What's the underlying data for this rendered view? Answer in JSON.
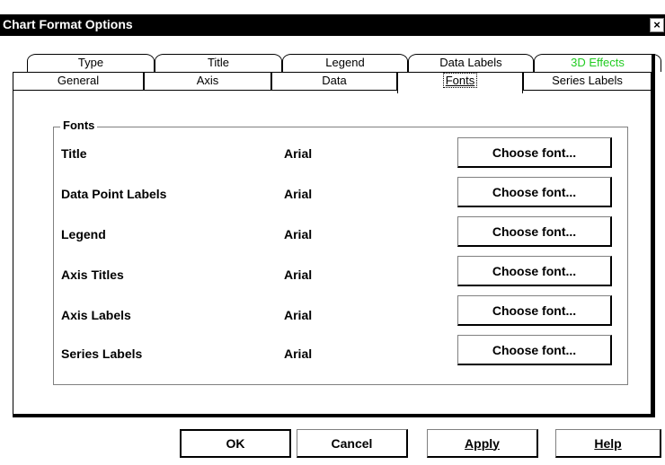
{
  "window": {
    "title": "Chart Format Options",
    "close_glyph": "×"
  },
  "tabs": {
    "back_row": [
      {
        "label": "Type"
      },
      {
        "label": "Title"
      },
      {
        "label": "Legend"
      },
      {
        "label": "Data Labels"
      },
      {
        "label": "3D Effects",
        "color": "#22cc22"
      }
    ],
    "front_row": [
      {
        "label": "General"
      },
      {
        "label": "Axis"
      },
      {
        "label": "Data"
      },
      {
        "label": "Fonts",
        "active": true
      },
      {
        "label": "Series Labels"
      }
    ]
  },
  "fonts_group": {
    "label": "Fonts",
    "rows": [
      {
        "label": "Title",
        "font": "Arial",
        "button": "Choose font..."
      },
      {
        "label": "Data Point Labels",
        "font": "Arial",
        "button": "Choose font..."
      },
      {
        "label": "Legend",
        "font": "Arial",
        "button": "Choose font..."
      },
      {
        "label": "Axis Titles",
        "font": "Arial",
        "button": "Choose font..."
      },
      {
        "label": "Axis Labels",
        "font": "Arial",
        "button": "Choose font..."
      },
      {
        "label": "Series Labels",
        "font": "Arial",
        "button": "Choose font..."
      }
    ]
  },
  "buttons": {
    "ok": "OK",
    "cancel": "Cancel",
    "apply": "Apply",
    "help": "Help"
  }
}
